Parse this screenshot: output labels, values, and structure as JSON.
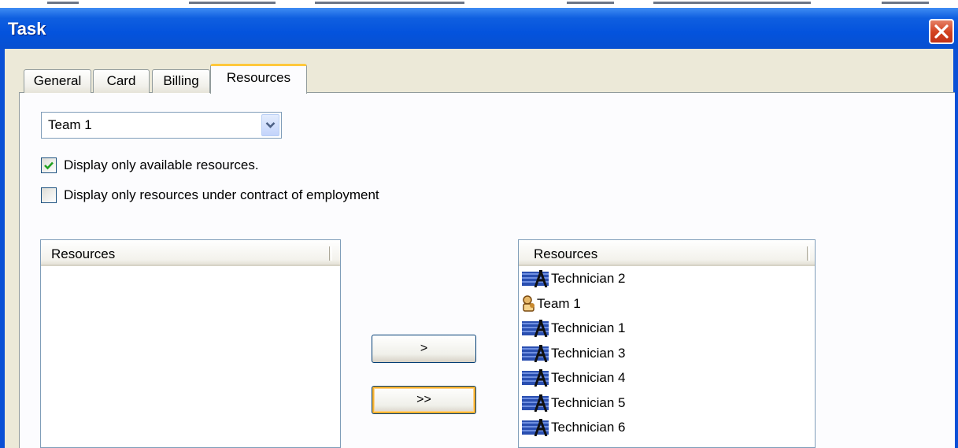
{
  "window": {
    "title": "Task"
  },
  "tabs": [
    {
      "label": "General"
    },
    {
      "label": "Card"
    },
    {
      "label": "Billing"
    },
    {
      "label": "Resources",
      "active": true
    }
  ],
  "team_select": {
    "value": "Team 1"
  },
  "checkboxes": [
    {
      "label": "Display only available resources.",
      "checked": true
    },
    {
      "label": "Display only resources under contract of employment",
      "checked": false
    }
  ],
  "available_list": {
    "header": "Resources",
    "items": []
  },
  "selected_list": {
    "header": "Resources",
    "items": [
      {
        "label": "Technician  2",
        "icon": "technician-icon"
      },
      {
        "label": "Team 1",
        "icon": "team-icon"
      },
      {
        "label": "Technician 1",
        "icon": "technician-icon"
      },
      {
        "label": "Technician 3",
        "icon": "technician-icon"
      },
      {
        "label": "Technician  4",
        "icon": "technician-icon"
      },
      {
        "label": "Technician  5",
        "icon": "technician-icon"
      },
      {
        "label": "Technician  6",
        "icon": "technician-icon"
      }
    ]
  },
  "buttons": {
    "add": ">",
    "add_all": ">>"
  },
  "colors": {
    "title_bar": "#0453dd",
    "accent_tab": "#ffc83c",
    "dialog": "#ece9d8"
  }
}
